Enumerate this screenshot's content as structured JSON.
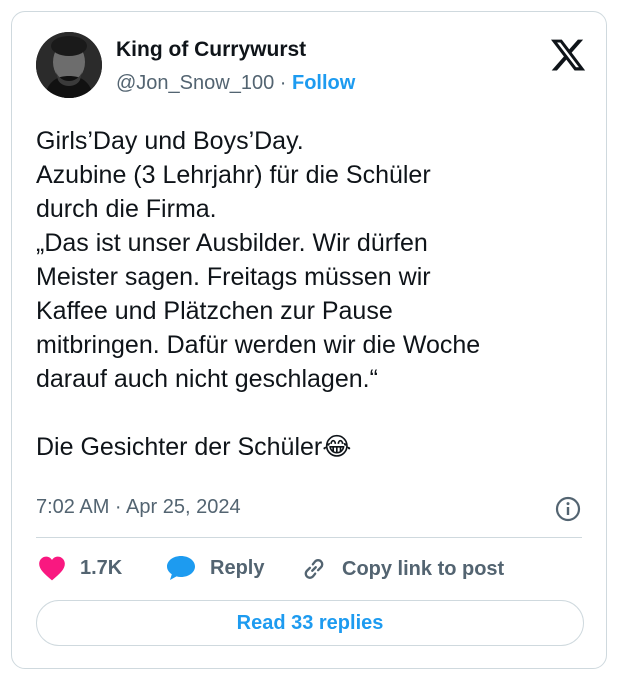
{
  "tweet": {
    "author_name": "King of Currywurst",
    "handle": "@Jon_Snow_100",
    "separator": "·",
    "follow_label": "Follow",
    "text": "Girls’Day und Boys’Day.\nAzubine (3 Lehrjahr) für die Schüler\ndurch die Firma.\n„Das ist unser Ausbilder. Wir dürfen\nMeister sagen. Freitags müssen wir\nKaffee und Plätzchen zur Pause\nmitbringen. Dafür werden wir die Woche\ndarauf auch nicht geschlagen.“\n\nDie Gesichter der Schüler😂",
    "timestamp": "7:02 AM · Apr 25, 2024"
  },
  "actions": {
    "likes": "1.7K",
    "reply_label": "Reply",
    "copy_link_label": "Copy link to post",
    "read_replies_label": "Read 33 replies"
  },
  "icons": {
    "like": "heart-icon",
    "reply": "speech-bubble-icon",
    "copy_link": "link-icon",
    "info": "info-icon",
    "brand": "x-logo-icon"
  },
  "colors": {
    "like": "#f91880",
    "accent": "#1d9bf0",
    "secondary_text": "#536471",
    "border": "#cfd9de"
  }
}
